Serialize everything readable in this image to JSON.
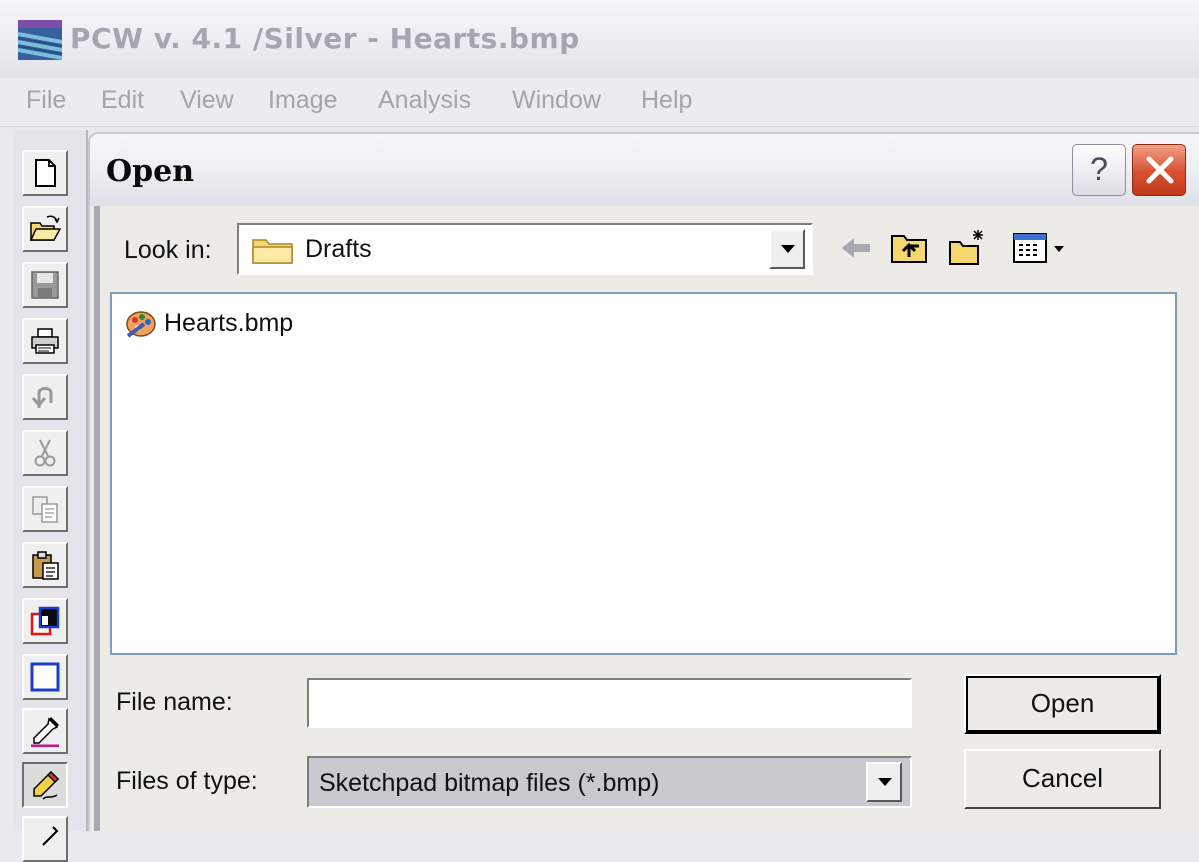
{
  "app": {
    "title": "PCW v. 4.1 /Silver - Hearts.bmp"
  },
  "menu": [
    "File",
    "Edit",
    "View",
    "Image",
    "Analysis",
    "Window",
    "Help"
  ],
  "toolbar": {
    "tools": [
      "new-document-icon",
      "open-folder-icon",
      "save-disk-icon",
      "printer-icon",
      "undo-icon",
      "cut-scissors-icon",
      "copy-icon",
      "paste-icon",
      "color-swap-icon",
      "rectangle-icon",
      "eyedropper-icon",
      "pencil-icon"
    ]
  },
  "dialog": {
    "title": "Open",
    "help_label": "?",
    "look_in_label": "Look in:",
    "look_in_value": "Drafts",
    "files": [
      {
        "name": "Hearts.bmp",
        "icon": "bitmap-file-icon"
      }
    ],
    "file_name_label": "File name:",
    "file_name_value": "",
    "files_of_type_label": "Files of type:",
    "files_of_type_value": "Sketchpad bitmap files (*.bmp)",
    "open_button": "Open",
    "cancel_button": "Cancel"
  }
}
